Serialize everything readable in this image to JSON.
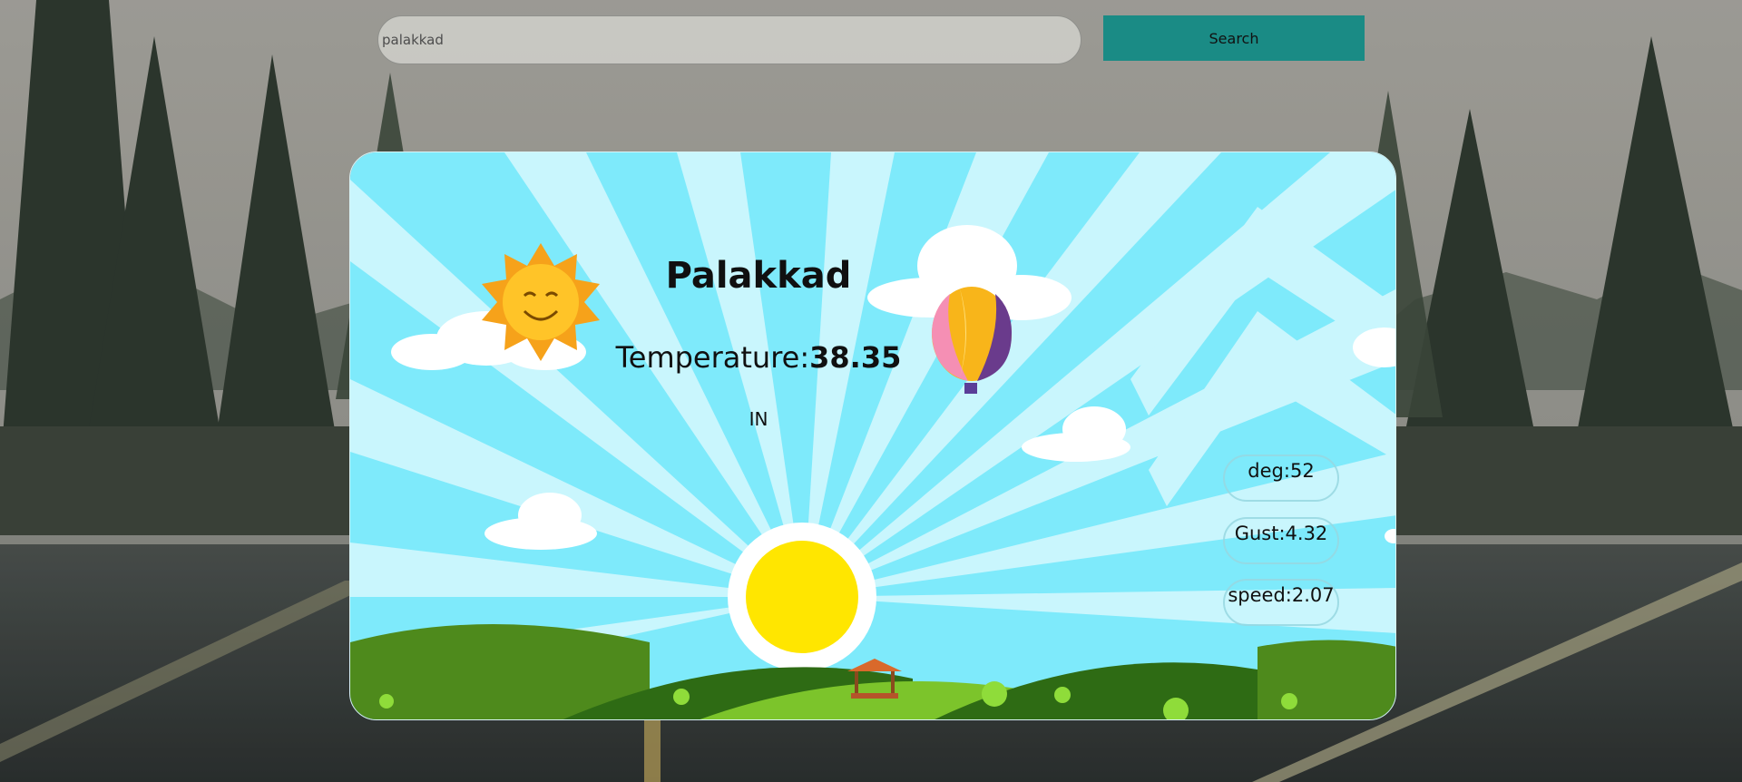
{
  "search": {
    "value": "palakkad",
    "placeholder": "",
    "button_label": "Search"
  },
  "weather": {
    "city": "Palakkad",
    "temperature_label": "Temperature:",
    "temperature_value": "38.35",
    "country": "IN",
    "wind": [
      {
        "label": "deg:52"
      },
      {
        "label": "Gust:4.32"
      },
      {
        "label": "speed:2.07"
      }
    ]
  },
  "colors": {
    "search_button": "#1a8b85",
    "sky": "#7eeafb",
    "sun": "#ffe600"
  }
}
